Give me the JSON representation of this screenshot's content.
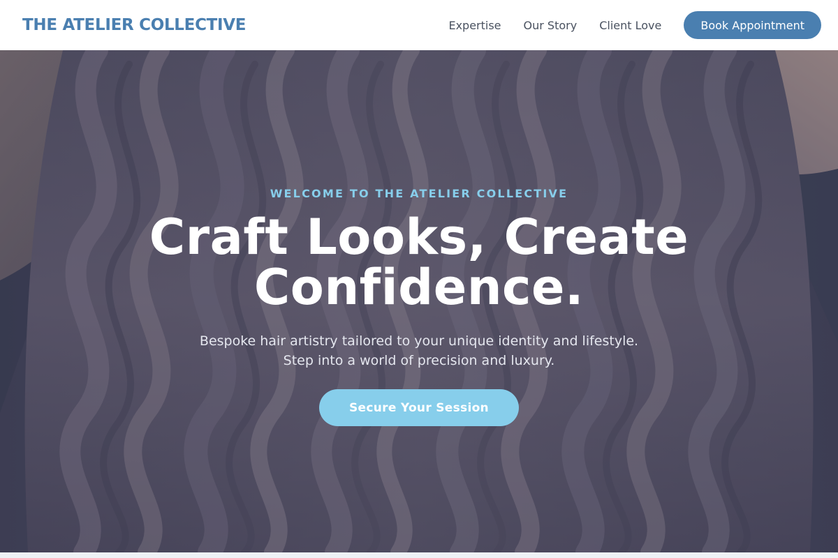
{
  "header": {
    "brand": "THE ATELIER COLLECTIVE",
    "nav": [
      {
        "label": "Expertise"
      },
      {
        "label": "Our Story"
      },
      {
        "label": "Client Love"
      }
    ],
    "cta_label": "Book Appointment"
  },
  "hero": {
    "eyebrow": "WELCOME TO THE ATELIER COLLECTIVE",
    "headline": "Craft Looks, Create Confidence.",
    "subtext_lines": [
      "Bespoke hair artistry tailored to your unique identity and lifestyle.",
      "Step into a world of precision and luxury."
    ],
    "cta_label": "Secure Your Session",
    "background_image": "wavy-hair-photo"
  },
  "colors": {
    "brand": "#4a7fb0",
    "accent": "#87ceeb",
    "nav_text": "#4a5260",
    "hero_overlay": "#2d304b"
  }
}
